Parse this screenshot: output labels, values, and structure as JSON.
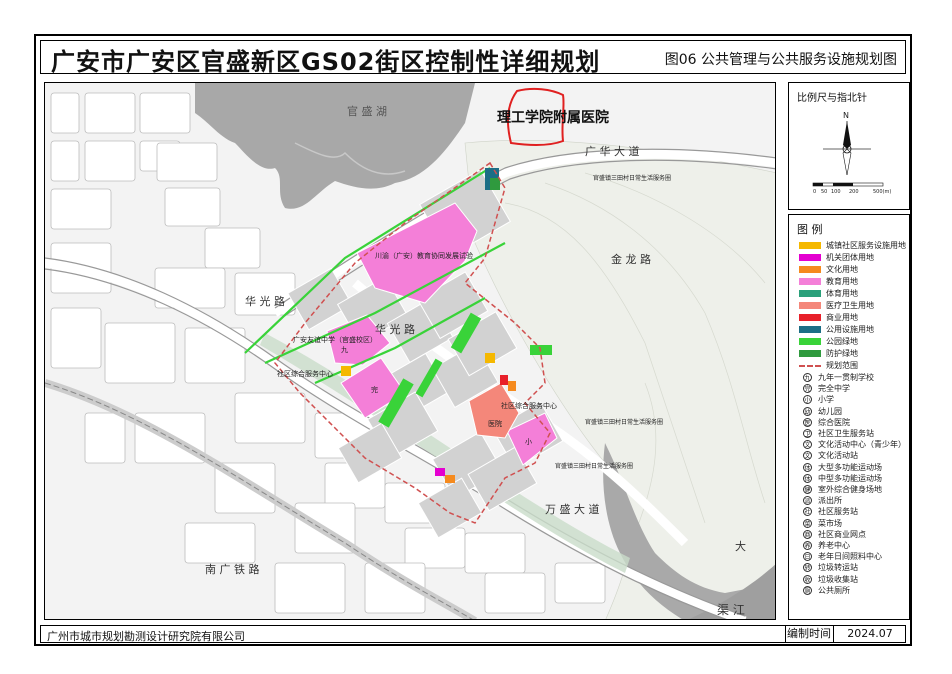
{
  "header": {
    "title": "广安市广安区官盛新区GS02街区控制性详细规划",
    "sheet": "图06   公共管理与公共服务设施规划图"
  },
  "compass_panel": {
    "title": "比例尺与指北针",
    "north": "N",
    "scale_ticks": [
      "0",
      "50",
      "100",
      "200",
      "500(m)"
    ]
  },
  "legend": {
    "title": "图  例",
    "land_uses": [
      {
        "label": "城镇社区服务设施用地",
        "color": "#f5b800"
      },
      {
        "label": "机关团体用地",
        "color": "#e400d0"
      },
      {
        "label": "文化用地",
        "color": "#f58a1e"
      },
      {
        "label": "教育用地",
        "color": "#f47fd8"
      },
      {
        "label": "体育用地",
        "color": "#2aa07a"
      },
      {
        "label": "医疗卫生用地",
        "color": "#f4877a"
      },
      {
        "label": "商业用地",
        "color": "#e8202a"
      },
      {
        "label": "公用设施用地",
        "color": "#1c6e86"
      },
      {
        "label": "公园绿地",
        "color": "#39d339"
      },
      {
        "label": "防护绿地",
        "color": "#2f9a3e"
      },
      {
        "label": "规划范围",
        "color": "#d05050"
      }
    ],
    "facilities": [
      {
        "symbol": "九",
        "label": "九年一贯制学校"
      },
      {
        "symbol": "完",
        "label": "完全中学"
      },
      {
        "symbol": "小",
        "label": "小学"
      },
      {
        "symbol": "幼",
        "label": "幼儿园"
      },
      {
        "symbol": "医",
        "label": "综合医院"
      },
      {
        "symbol": "卫",
        "label": "社区卫生服务站"
      },
      {
        "symbol": "文",
        "label": "文化活动中心（青少年）"
      },
      {
        "symbol": "文",
        "label": "文化活动站"
      },
      {
        "symbol": "体",
        "label": "大型多功能运动场"
      },
      {
        "symbol": "体",
        "label": "中型多功能运动场"
      },
      {
        "symbol": "健",
        "label": "室外综合健身场地"
      },
      {
        "symbol": "派",
        "label": "派出所"
      },
      {
        "symbol": "社",
        "label": "社区服务站"
      },
      {
        "symbol": "菜",
        "label": "菜市场"
      },
      {
        "symbol": "商",
        "label": "社区商业网点"
      },
      {
        "symbol": "养",
        "label": "养老中心"
      },
      {
        "symbol": "日",
        "label": "老年日间照料中心"
      },
      {
        "symbol": "转",
        "label": "垃圾转运站"
      },
      {
        "symbol": "收",
        "label": "垃圾收集站"
      },
      {
        "symbol": "厕",
        "label": "公共厕所"
      }
    ]
  },
  "map": {
    "lake_label": "官  盛  湖",
    "annotation": "理工学院附属医院",
    "road_upper": "广  华  大  道",
    "road_right": "金  龙  路",
    "road_center": "华  光  路",
    "road_lower": "万  盛  大  道",
    "road_left": "华  光  路",
    "road_south": "南  广  铁  路",
    "river": "渠  江",
    "river_right": "大",
    "blocks": {
      "edu_center": "川渝（广安）教育协同发展试验",
      "school_west": "广安友谊中学（官盛校区）",
      "community_center": "社区综合服务中心",
      "community_center_east": "社区综合服务中心",
      "hospital": "医院",
      "village_label": "官盛镇三田村日常生活服务圈",
      "village_label_2": "官盛镇三田村日常生活服务圈",
      "village_label_3": "官盛镇三田村日常生活服务圈"
    },
    "school_symbols": {
      "jiu": "九",
      "wan": "完",
      "xiao": "小"
    }
  },
  "footer": {
    "company": "广州市城市规划勘测设计研究院有限公司",
    "date_label": "编制时间",
    "date_value": "2024.07"
  }
}
